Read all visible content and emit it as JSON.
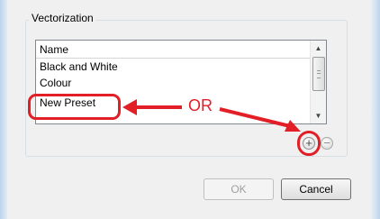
{
  "group": {
    "title": "Vectorization"
  },
  "list": {
    "header": "Name",
    "items": [
      "Black and White",
      "Colour",
      "New Preset"
    ]
  },
  "annotation": {
    "or_text": "OR",
    "color": "#e21e26"
  },
  "buttons": {
    "ok": "OK",
    "cancel": "Cancel",
    "add": "+",
    "remove": "−"
  }
}
